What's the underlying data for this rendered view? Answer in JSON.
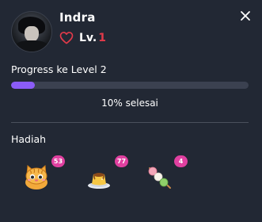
{
  "user": {
    "name": "Indra",
    "level_prefix": "Lv.",
    "level": "1",
    "avatar_icon": "avatar-icon"
  },
  "progress": {
    "title": "Progress ke Level 2",
    "fraction": 0.1,
    "text": "10% selesai",
    "fill_color": "#8b5cf6",
    "track_color": "#3b4150"
  },
  "gifts": {
    "title": "Hadiah",
    "items": [
      {
        "icon": "cat-icon",
        "count": "53"
      },
      {
        "icon": "pudding-icon",
        "count": "77"
      },
      {
        "icon": "dango-icon",
        "count": "4"
      }
    ]
  },
  "colors": {
    "background": "#222834",
    "accent": "#e23a4a",
    "badge": "#e040a0"
  }
}
